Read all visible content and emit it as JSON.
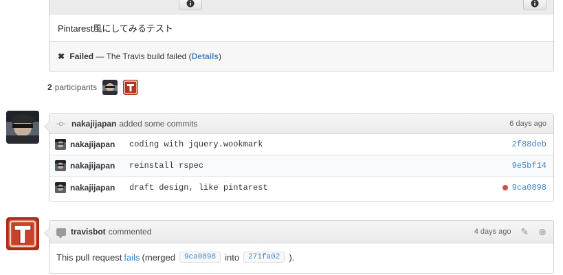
{
  "pull_request": {
    "description": "Pintarest風にしてみるテスト",
    "status": {
      "icon": "x-icon",
      "label": "Failed",
      "sep": "—",
      "text": "The Travis build failed (",
      "link": "Details",
      "close": ")"
    }
  },
  "participants": {
    "count": "2",
    "label": "participants"
  },
  "commits_event": {
    "author": "nakajijapan",
    "action": "added some commits",
    "time": "6 days ago",
    "commits": [
      {
        "author": "nakajijapan",
        "message": "coding with jquery.wookmark",
        "sha": "2f88deb",
        "failed": false
      },
      {
        "author": "nakajijapan",
        "message": "reinstall rspec",
        "sha": "9e5bf14",
        "failed": false
      },
      {
        "author": "nakajijapan",
        "message": "draft design, like pintarest",
        "sha": "9ca0898",
        "failed": true
      }
    ]
  },
  "comment_event": {
    "author": "travisbot",
    "action": "commented",
    "time": "4 days ago",
    "body_prefix": "This pull request",
    "body_link": "fails",
    "body_mid": "(merged",
    "sha_from": "9ca0898",
    "into": "into",
    "sha_to": "271fa02",
    "body_end": ")."
  },
  "colors": {
    "link": "#4183c4",
    "fail_dot": "#c5554a",
    "travis_red": "#c0392b"
  }
}
